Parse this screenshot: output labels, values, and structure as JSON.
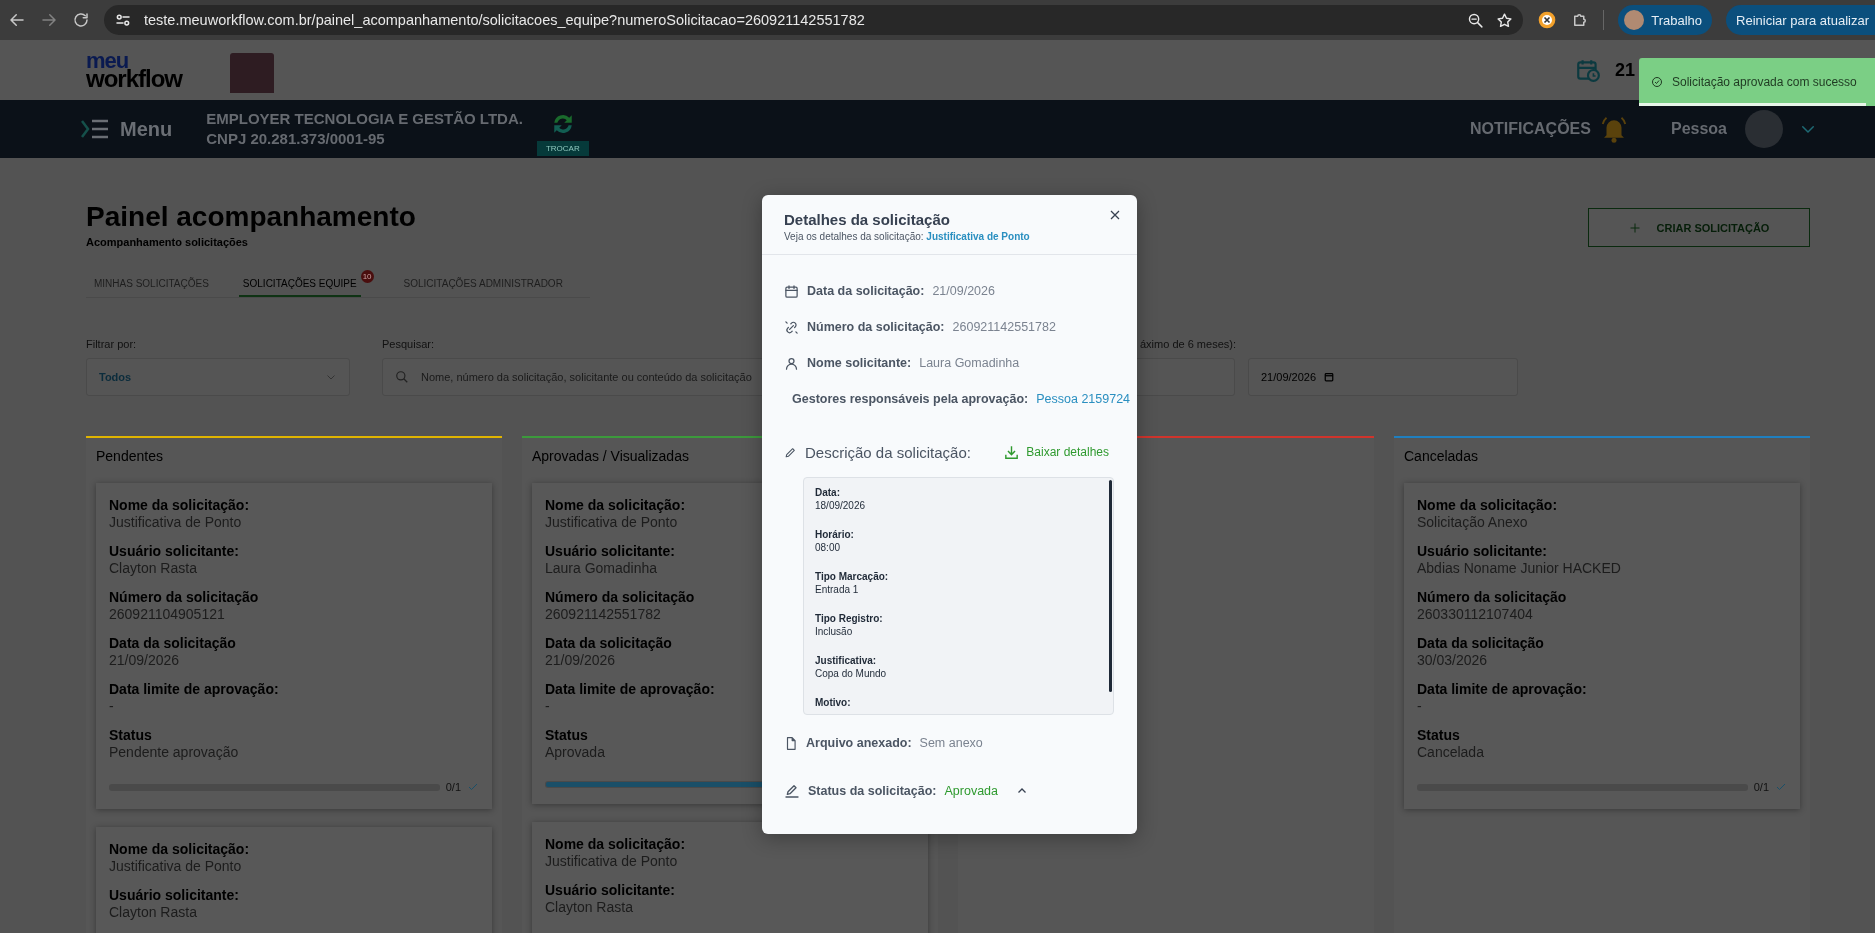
{
  "browser": {
    "url": "teste.meuworkflow.com.br/painel_acompanhamento/solicitacoes_equipe?numeroSolicitacao=260921142551782",
    "profile": "Trabalho",
    "update_button": "Reiniciar para atualizar"
  },
  "header": {
    "logo_top": "meu",
    "logo_bottom": "workflow",
    "date": "21",
    "menu": "Menu",
    "company": "EMPLOYER TECNOLOGIA E GESTÃO LTDA.",
    "cnpj": "CNPJ 20.281.373/0001-95",
    "switch_button": "TROCAR",
    "notifications": "NOTIFICAÇÕES",
    "user": "Pessoa"
  },
  "page": {
    "title": "Painel acompanhamento",
    "subtitle": "Acompanhamento solicitações",
    "create_button": "CRIAR SOLICITAÇÃO"
  },
  "tabs": [
    {
      "label": "MINHAS SOLICITAÇÕES",
      "selected": false
    },
    {
      "label": "SOLICITAÇÕES EQUIPE",
      "selected": true,
      "badge": "10"
    },
    {
      "label": "SOLICITAÇÕES ADMINISTRADOR",
      "selected": false
    }
  ],
  "filters": {
    "filter_label": "Filtrar por:",
    "filter_value": "Todos",
    "search_label": "Pesquisar:",
    "search_placeholder": "Nome, número da solicitação, solicitante ou conteúdo da solicitação",
    "period_label": "áximo de 6 meses):",
    "date_to": "21/09/2026"
  },
  "columns": [
    {
      "title": "Pendentes",
      "color": "#e0b400",
      "cards": [
        {
          "fields": [
            {
              "label": "Nome da solicitação:",
              "value": "Justificativa de Ponto"
            },
            {
              "label": "Usuário solicitante:",
              "value": "Clayton Rasta"
            },
            {
              "label": "Número da solicitação",
              "value": "260921104905121"
            },
            {
              "label": "Data da solicitação",
              "value": "21/09/2026"
            },
            {
              "label": "Data limite de aprovação:",
              "value": "-"
            },
            {
              "label": "Status",
              "value": "Pendente aprovação"
            }
          ],
          "progress": {
            "level": 0,
            "count": "0/1"
          }
        },
        {
          "fields": [
            {
              "label": "Nome da solicitação:",
              "value": "Justificativa de Ponto"
            },
            {
              "label": "Usuário solicitante:",
              "value": "Clayton Rasta"
            }
          ]
        }
      ]
    },
    {
      "title": "Aprovadas / Visualizadas",
      "color": "#3c9a3c",
      "cards": [
        {
          "fields": [
            {
              "label": "Nome da solicitação:",
              "value": "Justificativa de Ponto"
            },
            {
              "label": "Usuário solicitante:",
              "value": "Laura Gomadinha"
            },
            {
              "label": "Número da solicitação",
              "value": "260921142551782"
            },
            {
              "label": "Data da solicitação",
              "value": "21/09/2026"
            },
            {
              "label": "Data limite de aprovação:",
              "value": "-"
            },
            {
              "label": "Status",
              "value": "Aprovada"
            }
          ],
          "progress": {
            "level": 1
          }
        },
        {
          "fields": [
            {
              "label": "Nome da solicitação:",
              "value": "Justificativa de Ponto"
            },
            {
              "label": "Usuário solicitante:",
              "value": "Clayton Rasta"
            }
          ]
        }
      ]
    },
    {
      "color": "#d0342c"
    },
    {
      "title": "Canceladas",
      "color": "#1f7fbf",
      "cards": [
        {
          "fields": [
            {
              "label": "Nome da solicitação:",
              "value": "Solicitação Anexo"
            },
            {
              "label": "Usuário solicitante:",
              "value": "Abdias Noname Junior HACKED"
            },
            {
              "label": "Número da solicitação",
              "value": "260330112107404"
            },
            {
              "label": "Data da solicitação",
              "value": "30/03/2026"
            },
            {
              "label": "Data limite de aprovação:",
              "value": "-"
            },
            {
              "label": "Status",
              "value": "Cancelada"
            }
          ],
          "progress": {
            "level": 0,
            "count": "0/1"
          }
        }
      ]
    }
  ],
  "modal": {
    "title": "Detalhes da solicitação",
    "subtitle": "Veja os detalhes da solicitação:",
    "request_name": "Justificativa de Ponto",
    "fields": [
      {
        "kind": "date",
        "label": "Data da solicitação:",
        "value": "21/09/2026"
      },
      {
        "kind": "number",
        "label": "Número da solicitação:",
        "value": "260921142551782"
      },
      {
        "kind": "person",
        "label": "Nome solicitante:",
        "value": "Laura Gomadinha"
      },
      {
        "kind": "managers",
        "label": "Gestores responsáveis pela aprovação:",
        "value": "Pessoa 2159724"
      }
    ],
    "description_title": "Descrição da solicitação:",
    "download": "Baixar detalhes",
    "description": [
      {
        "label": "Data:",
        "value": "18/09/2026"
      },
      {
        "label": "Horário:",
        "value": "08:00"
      },
      {
        "label": "Tipo Marcação:",
        "value": "Entrada 1"
      },
      {
        "label": "Tipo Registro:",
        "value": "Inclusão"
      },
      {
        "label": "Justificativa:",
        "value": "Copa do Mundo"
      },
      {
        "label": "Motivo:"
      }
    ],
    "attachment_label": "Arquivo anexado:",
    "attachment_value": "Sem anexo",
    "status_label": "Status da solicitação:",
    "status_value": "Aprovada"
  },
  "toast": {
    "message": "Solicitação aprovada com sucesso",
    "level": 0.96
  }
}
